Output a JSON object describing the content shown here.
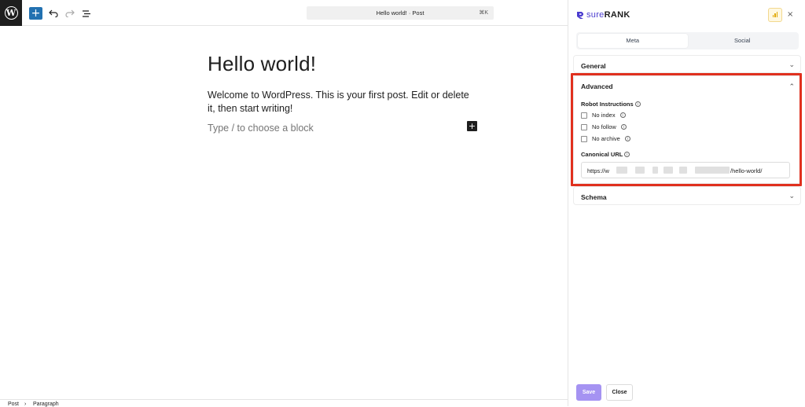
{
  "toolbar": {
    "add_label": "+",
    "command_title": "Hello world! · Post",
    "command_shortcut": "⌘K"
  },
  "editor": {
    "title": "Hello world!",
    "body": "Welcome to WordPress. This is your first post. Edit or delete it, then start writing!",
    "placeholder": "Type / to choose a block",
    "inline_add": "+"
  },
  "footer": {
    "breadcrumb": [
      "Post",
      "Paragraph"
    ],
    "separator": "›"
  },
  "sidebar": {
    "brand_sure": "sure",
    "brand_rank": "RANK",
    "close_icon": "×",
    "tabs": [
      {
        "label": "Meta",
        "active": true
      },
      {
        "label": "Social",
        "active": false
      }
    ],
    "general": {
      "label": "General",
      "chevron": "⌄"
    },
    "advanced": {
      "label": "Advanced",
      "chevron": "⌃",
      "robot_label": "Robot Instructions",
      "options": [
        {
          "label": "No index",
          "checked": false
        },
        {
          "label": "No follow",
          "checked": false
        },
        {
          "label": "No archive",
          "checked": false
        }
      ],
      "canonical_label": "Canonical URL",
      "canonical_prefix": "https://w",
      "canonical_suffix": "/hello-world/"
    },
    "schema": {
      "label": "Schema",
      "chevron": "⌄"
    },
    "save_label": "Save",
    "close_label": "Close"
  },
  "colors": {
    "accent": "#2271b1",
    "brand": "#4b3ccf",
    "save": "#a593f2",
    "highlight": "#e0301e"
  },
  "icons": [
    "wordpress-logo",
    "undo-icon",
    "redo-icon",
    "list-view-icon",
    "info-icon",
    "chart-icon"
  ]
}
